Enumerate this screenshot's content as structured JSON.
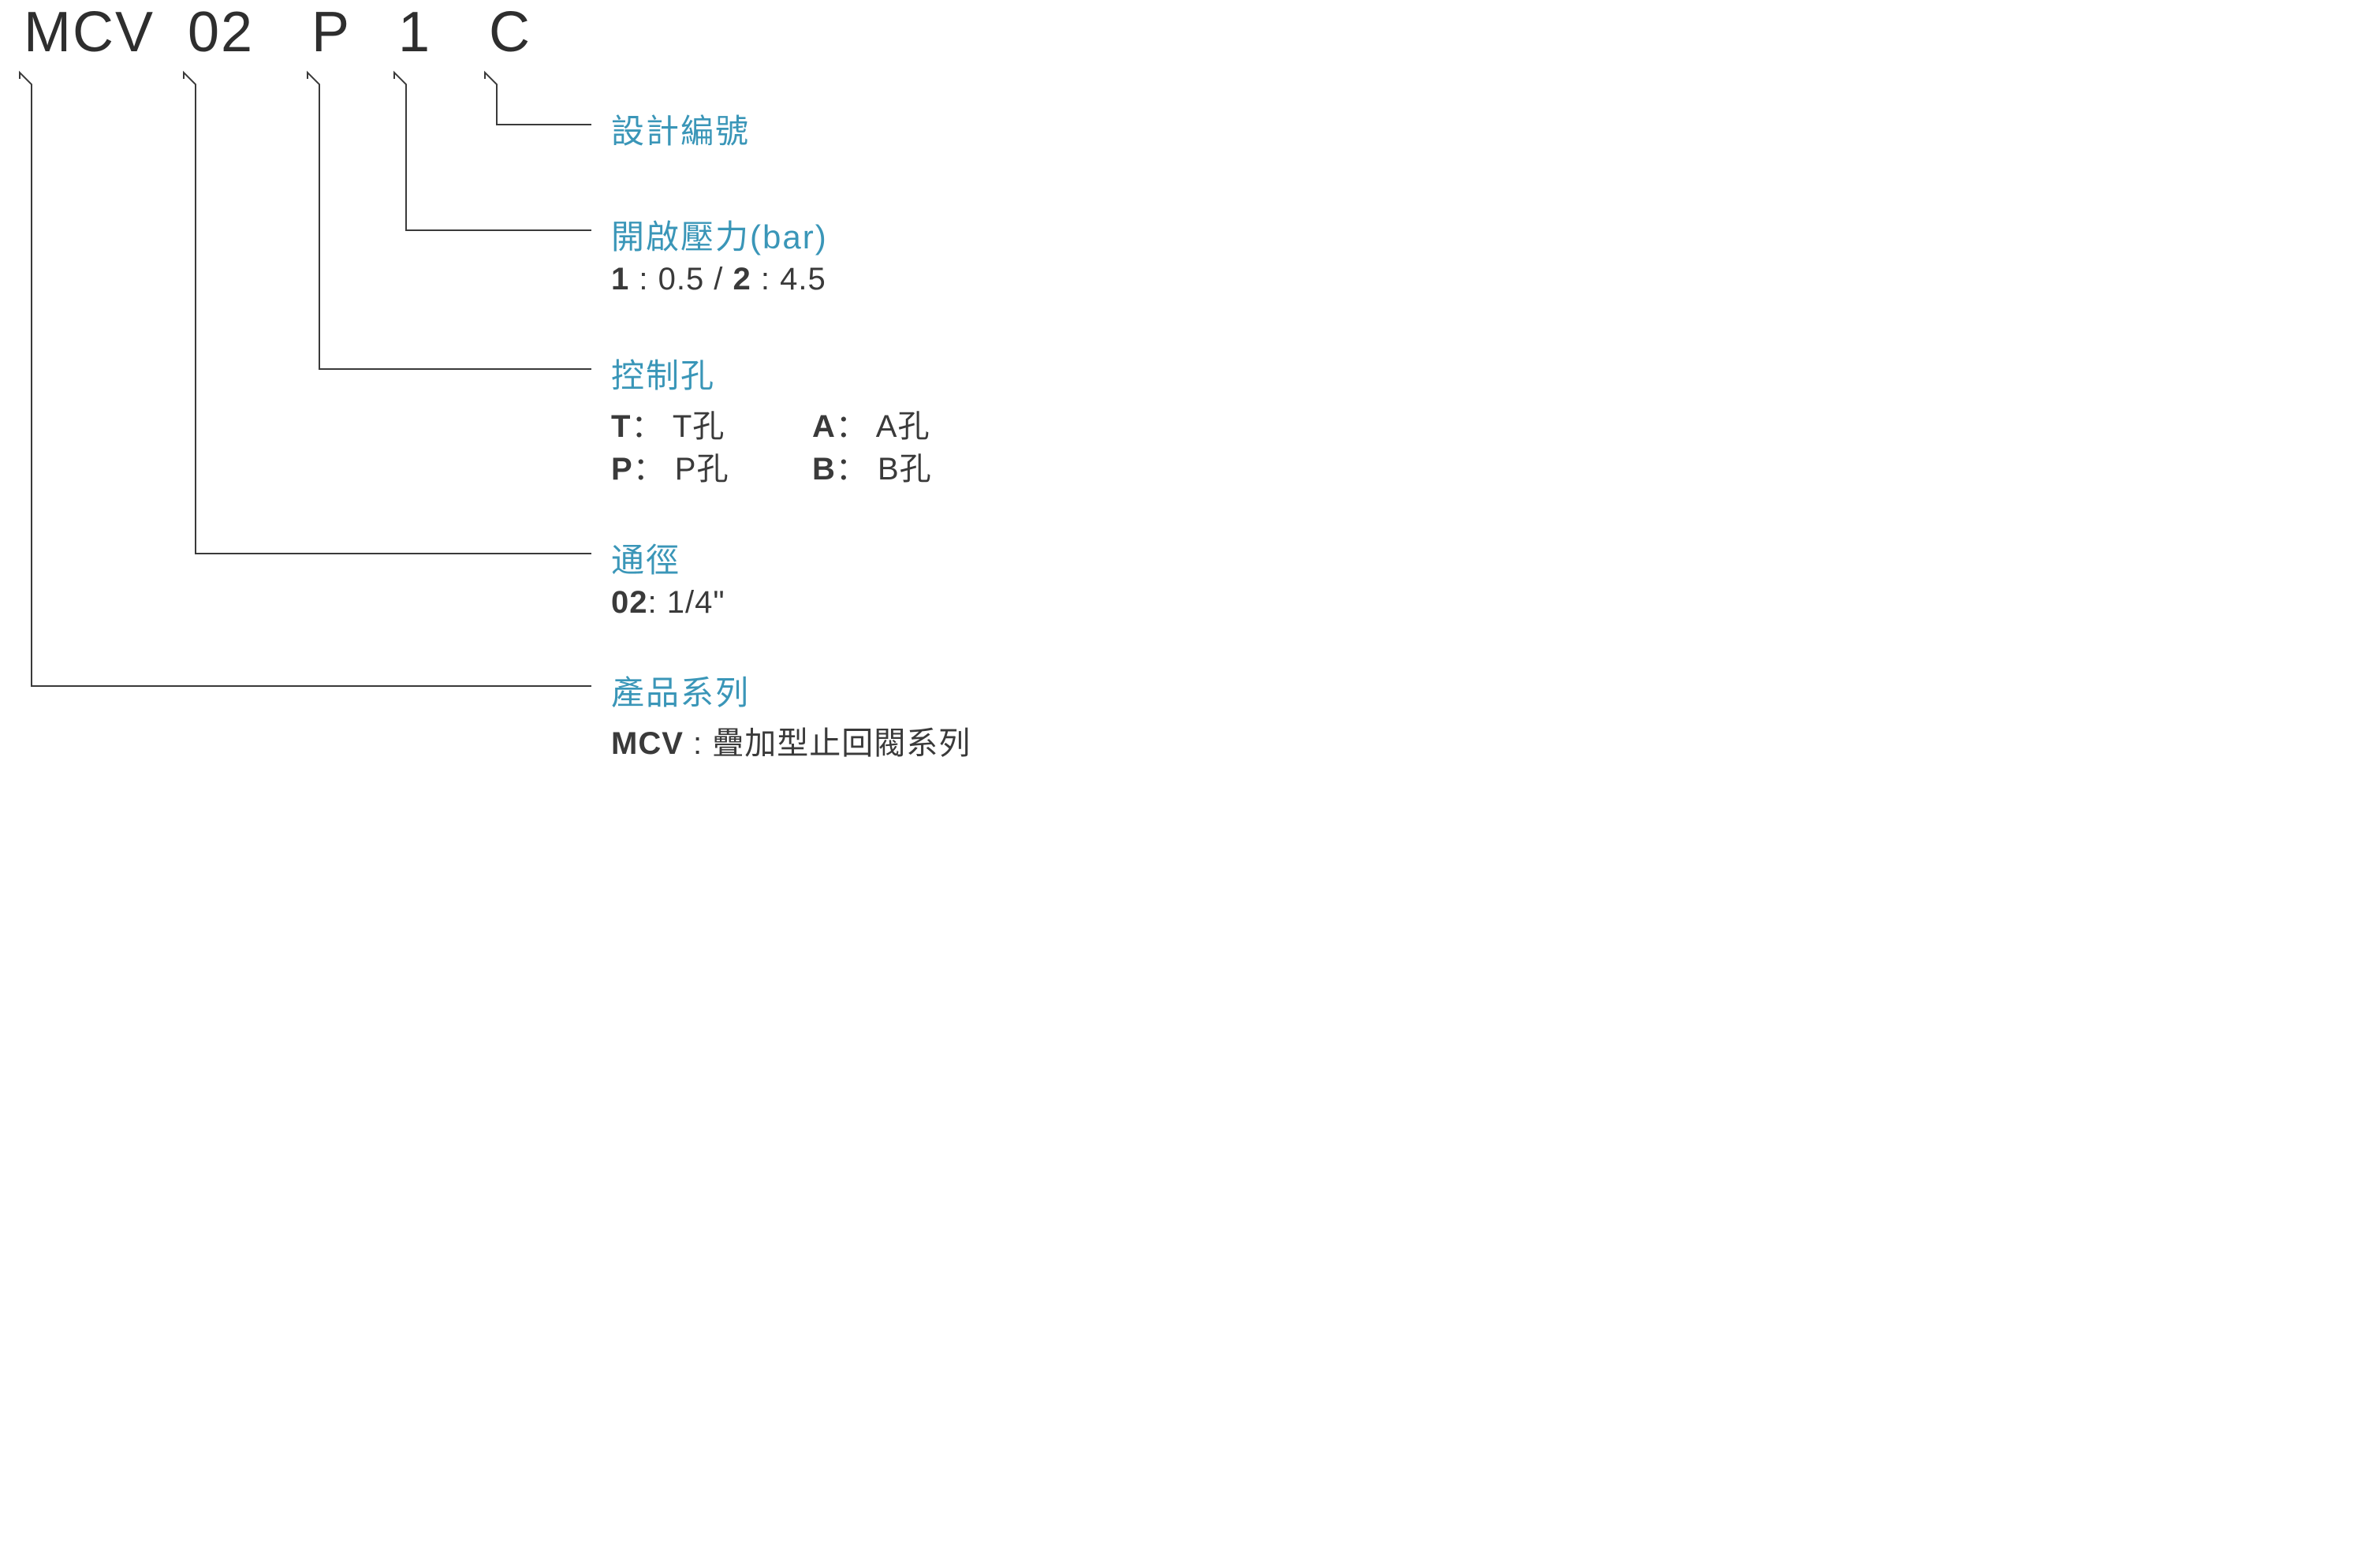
{
  "code": {
    "seg1": "MCV",
    "seg2": "02",
    "seg3": "P",
    "seg4": "1",
    "seg5": "C"
  },
  "labels": {
    "design_no": "設計編號",
    "cracking_pressure": "開啟壓力(bar)",
    "cracking_pressure_detail_prefix1": "1",
    "cracking_pressure_detail_mid": " : 0.5 / ",
    "cracking_pressure_detail_prefix2": "2",
    "cracking_pressure_detail_suffix": " : 4.5",
    "control_port": "控制孔",
    "control_port_T_label": "T",
    "control_port_T_val": "： T孔",
    "control_port_A_label": "A",
    "control_port_A_val": "： A孔",
    "control_port_P_label": "P",
    "control_port_P_val": "： P孔",
    "control_port_B_label": "B",
    "control_port_B_val": "： B孔",
    "size": "通徑",
    "size_code": "02",
    "size_val": ": 1/4\"",
    "series": "產品系列",
    "series_code": "MCV",
    "series_val": " : 疊加型止回閥系列"
  },
  "colors": {
    "heading": "#3a96b8",
    "text": "#3a3a3a",
    "line": "#3a3a3a"
  }
}
